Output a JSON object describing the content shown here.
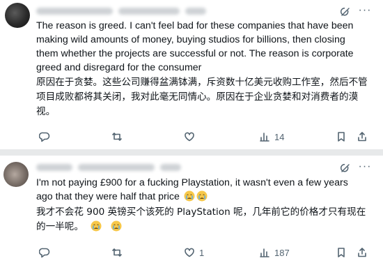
{
  "tweets": [
    {
      "text_en": "The reason is  greed. I can't feel bad for these companies that have been making wild amounts of money, buying studios for billions, then closing them whether the projects are successful or not. The reason is corporate greed and disregard for the consumer",
      "text_zh": "原因在于贪婪。这些公司赚得盆满钵满，斥资数十亿美元收购工作室，然后不管项目成败都将其关闭，我对此毫无同情心。原因在于企业贪婪和对消费者的漠视。",
      "actions": {
        "replies": "",
        "reposts": "",
        "likes": "",
        "views": "14"
      }
    },
    {
      "text_en": "I'm not paying £900 for a fucking Playstation, it wasn't even a few years ago that they were half that price",
      "text_zh": "我才不会花 900 英镑买个该死的 PlayStation 呢，几年前它的价格才只有现在的一半呢。",
      "actions": {
        "replies": "",
        "reposts": "",
        "likes": "1",
        "views": "187"
      }
    }
  ],
  "icons": {
    "grok": "grok-icon",
    "more": "more-icon",
    "reply": "reply-icon",
    "repost": "repost-icon",
    "like": "heart-icon",
    "views": "views-icon",
    "bookmark": "bookmark-icon",
    "share": "share-icon",
    "emoji": "crying-face-emoji"
  },
  "colors": {
    "text": "#0f1419",
    "muted": "#536471",
    "divider": "#e7e9ea",
    "emoji": "#f7c84a",
    "tear": "#5aa9e6"
  }
}
